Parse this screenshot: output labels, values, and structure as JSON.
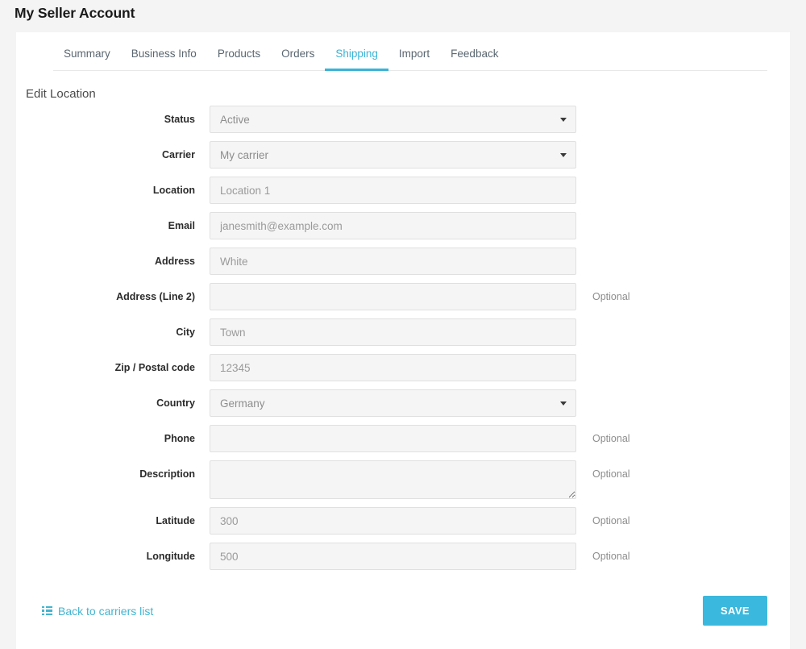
{
  "page": {
    "title": "My Seller Account"
  },
  "tabs": [
    {
      "label": "Summary",
      "active": false
    },
    {
      "label": "Business Info",
      "active": false
    },
    {
      "label": "Products",
      "active": false
    },
    {
      "label": "Orders",
      "active": false
    },
    {
      "label": "Shipping",
      "active": true
    },
    {
      "label": "Import",
      "active": false
    },
    {
      "label": "Feedback",
      "active": false
    }
  ],
  "section": {
    "title": "Edit Location"
  },
  "fields": [
    {
      "label": "Status",
      "type": "select",
      "value": "Active",
      "placeholder": "",
      "optional": ""
    },
    {
      "label": "Carrier",
      "type": "select",
      "value": "My carrier",
      "placeholder": "",
      "optional": ""
    },
    {
      "label": "Location",
      "type": "text",
      "value": "",
      "placeholder": "Location 1",
      "optional": ""
    },
    {
      "label": "Email",
      "type": "text",
      "value": "",
      "placeholder": "janesmith@example.com",
      "optional": ""
    },
    {
      "label": "Address",
      "type": "text",
      "value": "",
      "placeholder": "White",
      "optional": ""
    },
    {
      "label": "Address (Line 2)",
      "type": "text",
      "value": "",
      "placeholder": "",
      "optional": "Optional"
    },
    {
      "label": "City",
      "type": "text",
      "value": "",
      "placeholder": "Town",
      "optional": ""
    },
    {
      "label": "Zip / Postal code",
      "type": "text",
      "value": "",
      "placeholder": "12345",
      "optional": ""
    },
    {
      "label": "Country",
      "type": "select",
      "value": "Germany",
      "placeholder": "",
      "optional": ""
    },
    {
      "label": "Phone",
      "type": "text",
      "value": "",
      "placeholder": "",
      "optional": "Optional"
    },
    {
      "label": "Description",
      "type": "textarea",
      "value": "",
      "placeholder": "",
      "optional": "Optional"
    },
    {
      "label": "Latitude",
      "type": "text",
      "value": "",
      "placeholder": "300",
      "optional": "Optional"
    },
    {
      "label": "Longitude",
      "type": "text",
      "value": "",
      "placeholder": "500",
      "optional": "Optional"
    }
  ],
  "footer": {
    "back_link": "Back to carriers list",
    "back_link_icon": "list-icon",
    "save_label": "SAVE"
  },
  "colors": {
    "accent": "#3bb3d6",
    "save_button": "#3bb8dd",
    "link": "#43b4d0",
    "page_background": "#f4f4f4",
    "card_background": "#ffffff",
    "field_background": "#f5f5f5",
    "field_border": "#e0e0e0"
  }
}
